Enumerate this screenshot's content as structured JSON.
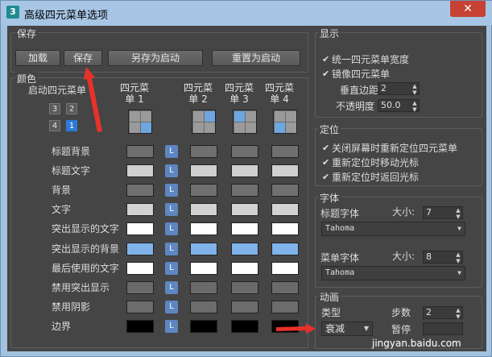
{
  "window": {
    "app_icon": "3",
    "title": "高级四元菜单选项",
    "close": "✕"
  },
  "save_group": {
    "label": "保存",
    "buttons": [
      "加载",
      "保存",
      "另存为启动",
      "重置为启动"
    ]
  },
  "color_group": {
    "label": "颜色",
    "start_label": "启动四元菜单",
    "quad_selector": [
      "3",
      "2",
      "4",
      "1"
    ],
    "columns": [
      "四元菜单 1",
      "四元菜单 2",
      "四元菜单 3",
      "四元菜单 4"
    ],
    "column_lines": [
      [
        "四元菜",
        "单 1"
      ],
      [
        "四元菜",
        "单 2"
      ],
      [
        "四元菜",
        "单 3"
      ],
      [
        "四元菜",
        "单 4"
      ]
    ],
    "lock_label": "L",
    "rows": [
      {
        "label": "标题背景",
        "colors": [
          "#6f6f6f",
          "#6f6f6f",
          "#6f6f6f",
          "#6f6f6f"
        ]
      },
      {
        "label": "标题文字",
        "colors": [
          "#cfcfcf",
          "#cfcfcf",
          "#cfcfcf",
          "#cfcfcf"
        ]
      },
      {
        "label": "背景",
        "colors": [
          "#707070",
          "#707070",
          "#707070",
          "#707070"
        ]
      },
      {
        "label": "文字",
        "colors": [
          "#d2d2d2",
          "#d2d2d2",
          "#d2d2d2",
          "#d2d2d2"
        ]
      },
      {
        "label": "突出显示的文字",
        "colors": [
          "#ffffff",
          "#ffffff",
          "#ffffff",
          "#ffffff"
        ]
      },
      {
        "label": "突出显示的背景",
        "colors": [
          "#7fb3ea",
          "#7fb3ea",
          "#7fb3ea",
          "#7fb3ea"
        ]
      },
      {
        "label": "最后使用的文字",
        "colors": [
          "#ffffff",
          "#ffffff",
          "#ffffff",
          "#ffffff"
        ]
      },
      {
        "label": "禁用突出显示",
        "colors": [
          "#6a6a6a",
          "#6a6a6a",
          "#6a6a6a",
          "#6a6a6a"
        ]
      },
      {
        "label": "禁用阴影",
        "colors": [
          "#6c6c6c",
          "#6c6c6c",
          "#6c6c6c",
          "#6c6c6c"
        ]
      },
      {
        "label": "边界",
        "colors": [
          "#000000",
          "#000000",
          "#000000",
          "#000000"
        ]
      }
    ]
  },
  "display_group": {
    "label": "显示",
    "check1": "统一四元菜单宽度",
    "check2": "镜像四元菜单",
    "vmargin_label": "垂直边距",
    "vmargin_value": "2",
    "opacity_label": "不透明度",
    "opacity_value": "50.0"
  },
  "position_group": {
    "label": "定位",
    "items": [
      "关闭屏幕时重新定位四元菜单",
      "重新定位时移动光标",
      "重新定位时返回光标"
    ]
  },
  "font_group": {
    "label": "字体",
    "title_font_label": "标题字体",
    "title_size_label": "大小:",
    "title_size": "7",
    "title_font": "Tahoma",
    "menu_font_label": "菜单字体",
    "menu_size_label": "大小:",
    "menu_size": "8",
    "menu_font": "Tahoma"
  },
  "anim_group": {
    "label": "动画",
    "type_label": "类型",
    "steps_label": "步数",
    "steps_value": "2",
    "type_value": "衰减",
    "time_label": "暂停"
  },
  "watermark": "jingyan.baidu.com",
  "check_glyph": "✔",
  "spin_glyph": "▲▼",
  "combo_glyph": "▼",
  "colors": {
    "highlight": "#7fb3ea",
    "accent": "#2e79d8",
    "annotation": "#e8312a"
  }
}
